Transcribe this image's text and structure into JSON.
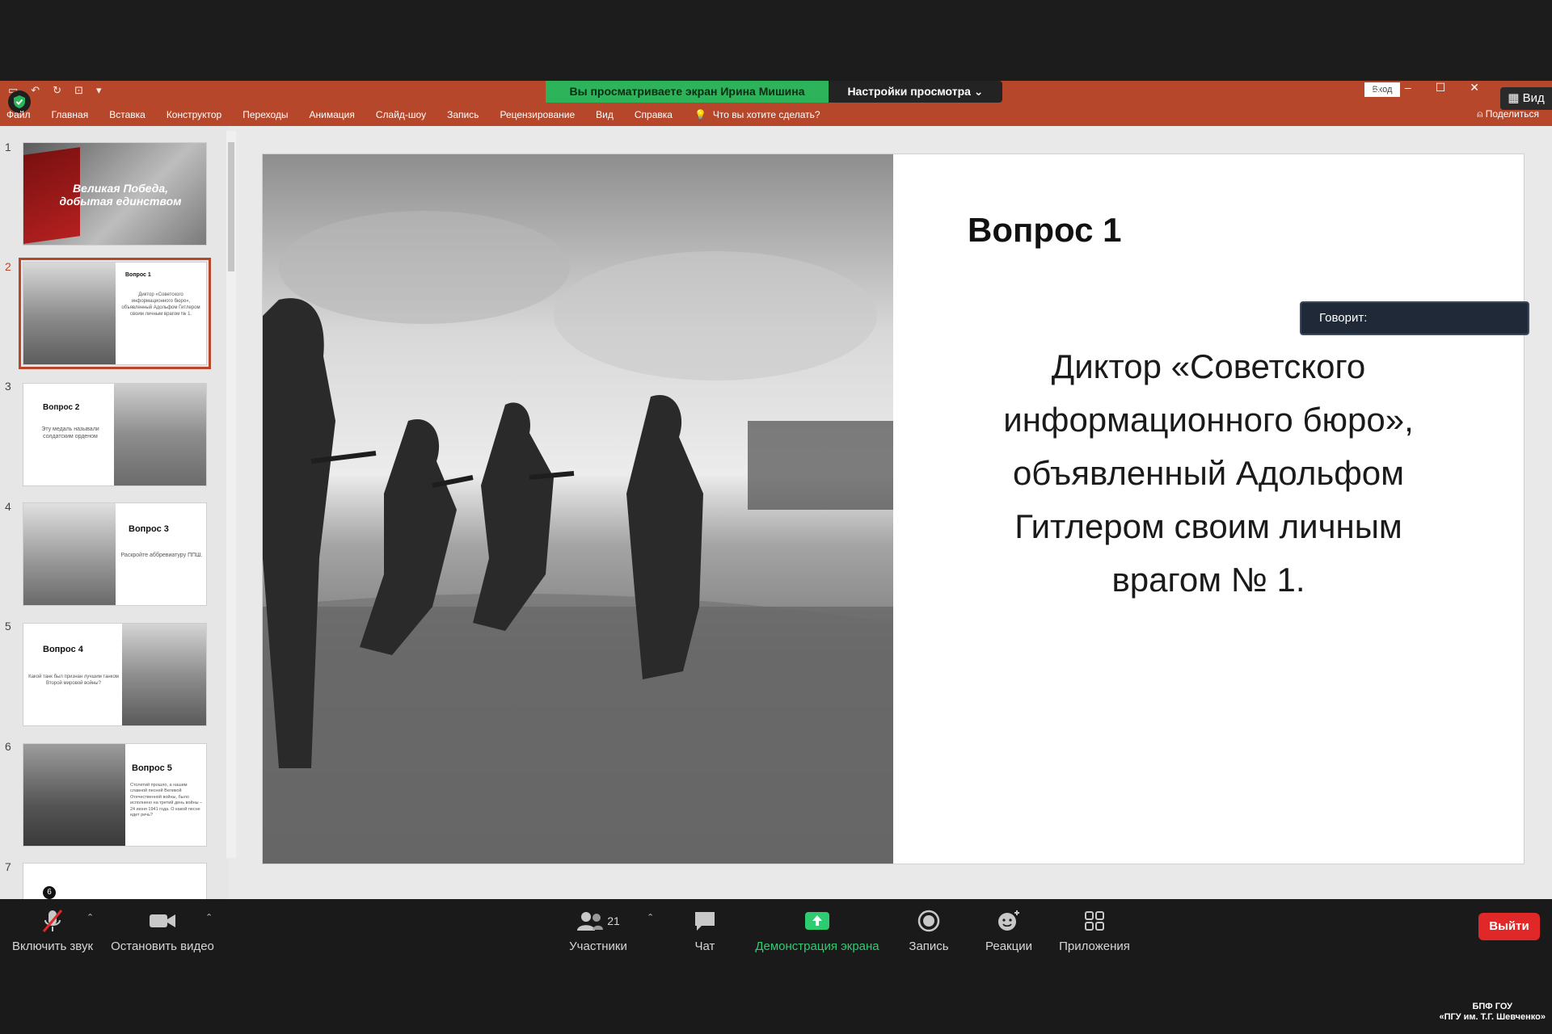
{
  "ppt": {
    "sharing_banner": "Вы просматриваете экран Ирина Мишина",
    "view_options": "Настройки просмотра ⌄",
    "login_label": "Вход",
    "view_button": "Вид",
    "share_label": "Поделиться",
    "tell_me": "Что вы хотите сделать?",
    "menu": [
      "Файл",
      "Главная",
      "Вставка",
      "Конструктор",
      "Переходы",
      "Анимация",
      "Слайд-шоу",
      "Запись",
      "Рецензирование",
      "Вид",
      "Справка"
    ]
  },
  "thumbnails": [
    {
      "num": "1",
      "title": "Великая Победа, добытая единством"
    },
    {
      "num": "2",
      "title": "Вопрос 1",
      "text": "Диктор «Советского информационного бюро», объявленный Адольфом Гитлером своим личным врагом № 1."
    },
    {
      "num": "3",
      "title": "Вопрос 2",
      "text": "Эту медаль называли солдатским орденом"
    },
    {
      "num": "4",
      "title": "Вопрос 3",
      "text": "Раскройте аббревиатуру ППШ."
    },
    {
      "num": "5",
      "title": "Вопрос 4",
      "text": "Какой танк был признан лучшим танком Второй мировой войны?"
    },
    {
      "num": "6",
      "title": "Вопрос 5",
      "text": "Столетий прошло, а нашим славной песней Великой Отечественной войны, было исполнено на третий день войны – 24 июня 1941 года. О какой песне идет речь?"
    },
    {
      "num": "7",
      "badge": "6"
    }
  ],
  "slide": {
    "title": "Вопрос 1",
    "body": "Диктор «Советского информационного бюро», объявленный Адольфом Гитлером своим личным врагом № 1."
  },
  "speaking": "Говорит:",
  "zoom": {
    "mute": "Включить звук",
    "video": "Остановить видео",
    "participants": "Участники",
    "participants_count": "21",
    "chat": "Чат",
    "share": "Демонстрация экрана",
    "record": "Запись",
    "reactions": "Реакции",
    "apps": "Приложения",
    "leave": "Выйти"
  },
  "watermark": {
    "line1": "БПФ ГОУ",
    "line2": "«ПГУ им. Т.Г. Шевченко»"
  },
  "colors": {
    "ribbon": "#b7472a",
    "banner": "#2db45a",
    "leave": "#e02828",
    "share_green": "#2ecc71"
  }
}
